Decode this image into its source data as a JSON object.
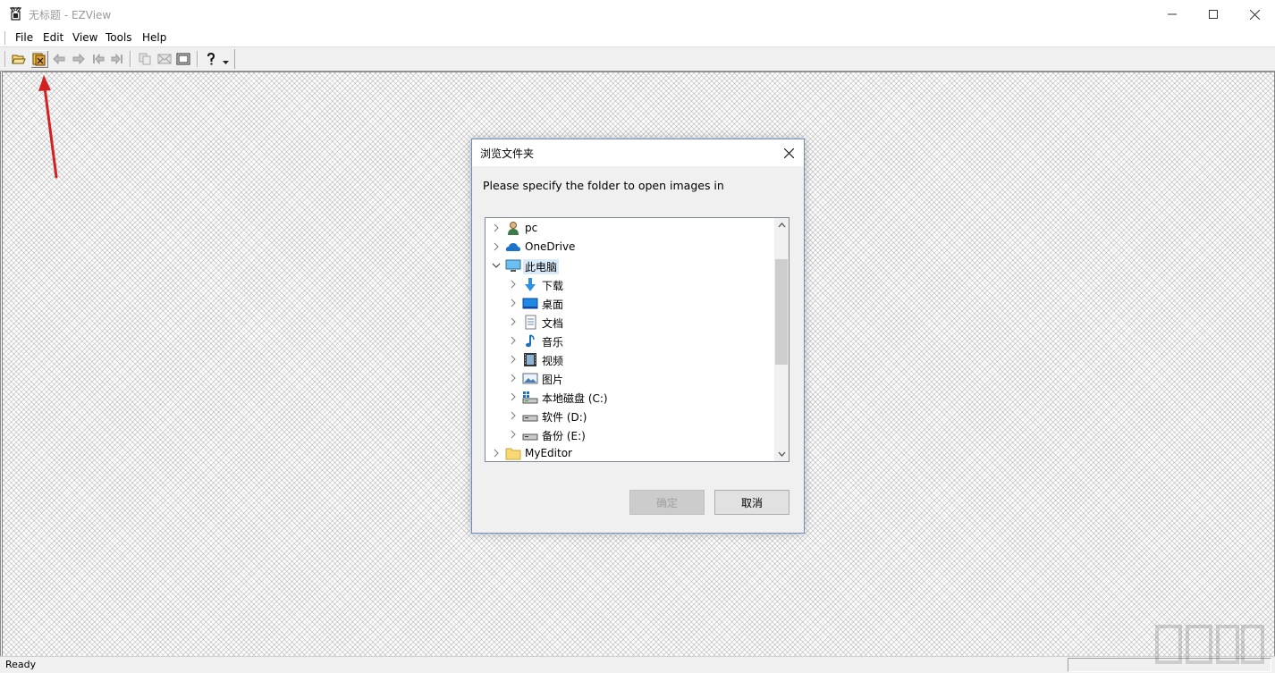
{
  "window": {
    "title": "无标题 - EZView",
    "controls": [
      "minimize",
      "maximize",
      "close"
    ]
  },
  "menu": [
    {
      "label": "File"
    },
    {
      "label": "Edit"
    },
    {
      "label": "View"
    },
    {
      "label": "Tools"
    },
    {
      "label": "Help"
    }
  ],
  "toolbar": {
    "buttons": [
      "open-folder-icon",
      "browse-folder-icon",
      "back-arrow-icon",
      "forward-arrow-icon",
      "first-image-icon",
      "last-image-icon",
      "copy-icon",
      "envelope-icon",
      "fullscreen-icon",
      "help-icon",
      "dropdown-icon"
    ],
    "active": "browse-folder-icon"
  },
  "status": {
    "text": "Ready"
  },
  "dialog": {
    "title": "浏览文件夹",
    "prompt": "Please specify the folder to open images in",
    "tree": [
      {
        "label": "pc",
        "icon": "user-icon",
        "expanded": false
      },
      {
        "label": "OneDrive",
        "icon": "cloud-icon",
        "expanded": false
      },
      {
        "label": "此电脑",
        "icon": "computer-icon",
        "expanded": true,
        "selected": true
      },
      {
        "label": "下载",
        "icon": "download-icon",
        "expanded": false
      },
      {
        "label": "桌面",
        "icon": "desktop-icon",
        "expanded": false
      },
      {
        "label": "文档",
        "icon": "document-icon",
        "expanded": false
      },
      {
        "label": "音乐",
        "icon": "music-icon",
        "expanded": false
      },
      {
        "label": "视频",
        "icon": "video-icon",
        "expanded": false
      },
      {
        "label": "图片",
        "icon": "picture-icon",
        "expanded": false
      },
      {
        "label": "本地磁盘 (C:)",
        "icon": "system-drive-icon",
        "expanded": false
      },
      {
        "label": "软件 (D:)",
        "icon": "drive-icon",
        "expanded": false
      },
      {
        "label": "备份 (E:)",
        "icon": "drive-icon",
        "expanded": false
      },
      {
        "label": "MyEditor",
        "icon": "folder-icon",
        "expanded": false
      }
    ],
    "ok_label": "确定",
    "ok_enabled": false,
    "cancel_label": "取消"
  },
  "colors": {
    "selection": "#d9ebf9",
    "dialog_border": "#6a8fc8",
    "annotation_arrow": "#d42020"
  }
}
